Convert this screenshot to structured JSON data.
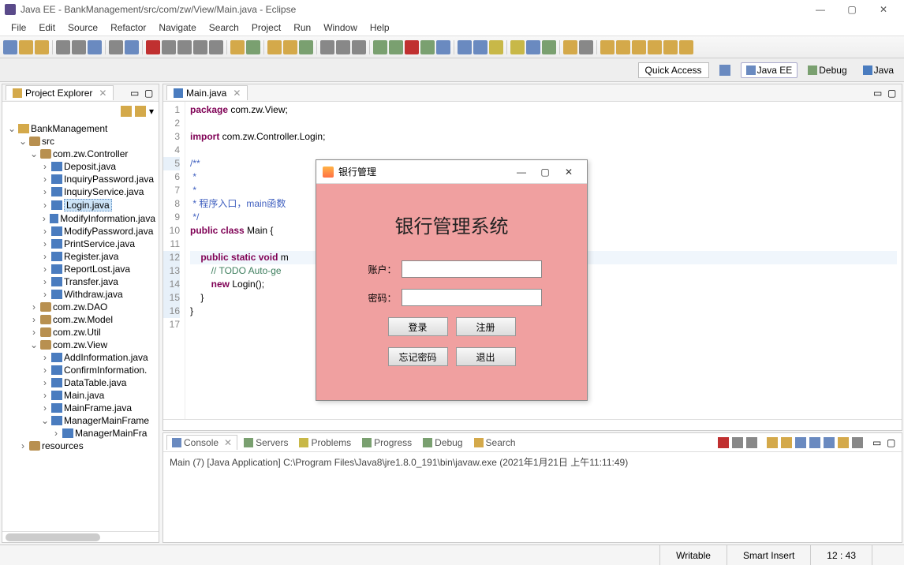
{
  "window": {
    "title": "Java EE - BankManagement/src/com/zw/View/Main.java - Eclipse"
  },
  "menu": [
    "File",
    "Edit",
    "Source",
    "Refactor",
    "Navigate",
    "Search",
    "Project",
    "Run",
    "Window",
    "Help"
  ],
  "quickAccess": "Quick Access",
  "perspectives": {
    "javaee": "Java EE",
    "debug": "Debug",
    "java": "Java"
  },
  "projectExplorer": {
    "title": "Project Explorer",
    "tree": [
      {
        "indent": 0,
        "arrow": "v",
        "icon": "proj",
        "label": "BankManagement"
      },
      {
        "indent": 1,
        "arrow": "v",
        "icon": "pkg",
        "label": "src"
      },
      {
        "indent": 2,
        "arrow": "v",
        "icon": "pkg",
        "label": "com.zw.Controller"
      },
      {
        "indent": 3,
        "arrow": ">",
        "icon": "java",
        "label": "Deposit.java"
      },
      {
        "indent": 3,
        "arrow": ">",
        "icon": "java",
        "label": "InquiryPassword.java"
      },
      {
        "indent": 3,
        "arrow": ">",
        "icon": "java",
        "label": "InquiryService.java"
      },
      {
        "indent": 3,
        "arrow": ">",
        "icon": "java",
        "label": "Login.java",
        "selected": true
      },
      {
        "indent": 3,
        "arrow": ">",
        "icon": "java",
        "label": "ModifyInformation.java"
      },
      {
        "indent": 3,
        "arrow": ">",
        "icon": "java",
        "label": "ModifyPassword.java"
      },
      {
        "indent": 3,
        "arrow": ">",
        "icon": "java",
        "label": "PrintService.java"
      },
      {
        "indent": 3,
        "arrow": ">",
        "icon": "java",
        "label": "Register.java"
      },
      {
        "indent": 3,
        "arrow": ">",
        "icon": "java",
        "label": "ReportLost.java"
      },
      {
        "indent": 3,
        "arrow": ">",
        "icon": "java",
        "label": "Transfer.java"
      },
      {
        "indent": 3,
        "arrow": ">",
        "icon": "java",
        "label": "Withdraw.java"
      },
      {
        "indent": 2,
        "arrow": ">",
        "icon": "pkg",
        "label": "com.zw.DAO"
      },
      {
        "indent": 2,
        "arrow": ">",
        "icon": "pkg",
        "label": "com.zw.Model"
      },
      {
        "indent": 2,
        "arrow": ">",
        "icon": "pkg",
        "label": "com.zw.Util"
      },
      {
        "indent": 2,
        "arrow": "v",
        "icon": "pkg",
        "label": "com.zw.View"
      },
      {
        "indent": 3,
        "arrow": ">",
        "icon": "java",
        "label": "AddInformation.java"
      },
      {
        "indent": 3,
        "arrow": ">",
        "icon": "java",
        "label": "ConfirmInformation."
      },
      {
        "indent": 3,
        "arrow": ">",
        "icon": "java",
        "label": "DataTable.java"
      },
      {
        "indent": 3,
        "arrow": ">",
        "icon": "java",
        "label": "Main.java"
      },
      {
        "indent": 3,
        "arrow": ">",
        "icon": "java",
        "label": "MainFrame.java"
      },
      {
        "indent": 3,
        "arrow": "v",
        "icon": "java",
        "label": "ManagerMainFrame"
      },
      {
        "indent": 4,
        "arrow": ">",
        "icon": "java",
        "label": "ManagerMainFra"
      },
      {
        "indent": 1,
        "arrow": ">",
        "icon": "pkg",
        "label": "resources"
      }
    ]
  },
  "editor": {
    "tabName": "Main.java",
    "lines": [
      {
        "n": 1,
        "html": "<span class='kw'>package</span> com.zw.View;"
      },
      {
        "n": 2,
        "html": ""
      },
      {
        "n": 3,
        "html": "<span class='kw'>import</span> com.zw.Controller.Login;"
      },
      {
        "n": 4,
        "html": ""
      },
      {
        "n": 5,
        "html": "<span class='jdoc'>/**</span>",
        "mark": true
      },
      {
        "n": 6,
        "html": "<span class='jdoc'> *</span>"
      },
      {
        "n": 7,
        "html": "<span class='jdoc'> *</span>"
      },
      {
        "n": 8,
        "html": "<span class='jdoc'> * 程序入口，main函数</span>"
      },
      {
        "n": 9,
        "html": "<span class='jdoc'> */</span>"
      },
      {
        "n": 10,
        "html": "<span class='kw'>public</span> <span class='kw'>class</span> Main {"
      },
      {
        "n": 11,
        "html": ""
      },
      {
        "n": 12,
        "html": "    <span class='kw'>public</span> <span class='kw'>static</span> <span class='kw'>void</span> m",
        "hl": true,
        "mark": true
      },
      {
        "n": 13,
        "html": "        <span class='cmt'>// TODO Auto-ge</span>",
        "mark": true
      },
      {
        "n": 14,
        "html": "        <span class='kw'>new</span> Login();",
        "mark": true
      },
      {
        "n": 15,
        "html": "    }",
        "mark": true
      },
      {
        "n": 16,
        "html": "}",
        "mark": true
      },
      {
        "n": 17,
        "html": ""
      }
    ]
  },
  "console": {
    "tabs": [
      "Console",
      "Servers",
      "Problems",
      "Progress",
      "Debug",
      "Search"
    ],
    "header": "Main (7) [Java Application] C:\\Program Files\\Java8\\jre1.8.0_191\\bin\\javaw.exe (2021年1月21日 上午11:11:49)"
  },
  "status": {
    "writable": "Writable",
    "insert": "Smart Insert",
    "pos": "12 : 43"
  },
  "dialog": {
    "title": "银行管理",
    "heading": "银行管理系统",
    "labels": {
      "account": "账户：",
      "password": "密码："
    },
    "buttons": {
      "login": "登录",
      "register": "注册",
      "forgot": "忘记密码",
      "exit": "退出"
    }
  }
}
